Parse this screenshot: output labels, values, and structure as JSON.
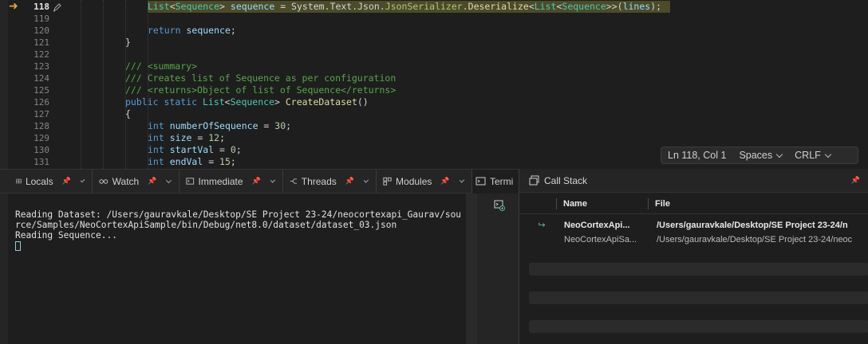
{
  "editor": {
    "line_numbers": [
      "118",
      "119",
      "120",
      "121",
      "122",
      "123",
      "124",
      "125",
      "126",
      "127",
      "128",
      "129",
      "130",
      "131"
    ],
    "status": {
      "position": "Ln 118, Col 1",
      "indent": "Spaces",
      "eol": "CRLF"
    }
  },
  "code_tokens": {
    "l118": [
      "List",
      "<",
      "Sequence",
      "> ",
      "sequence",
      " = System.Text.Json.",
      "JsonSerializer",
      ".",
      "Deserialize",
      "<",
      "List",
      "<",
      "Sequence",
      ">>(",
      "lines",
      ");"
    ],
    "l120": [
      "return",
      " ",
      "sequence",
      ";"
    ],
    "l121": [
      "}"
    ],
    "l123": "/// <summary>",
    "l124": "/// Creates list of Sequence as per configuration",
    "l125": "/// <returns>Object of list of Sequence</returns>",
    "l126": [
      "public",
      " ",
      "static",
      " ",
      "List",
      "<",
      "Sequence",
      "> ",
      "CreateDataset",
      "()"
    ],
    "l127": [
      "{"
    ],
    "l128": [
      "int",
      " ",
      "numberOfSequence",
      " = ",
      "30",
      ";"
    ],
    "l129": [
      "int",
      " ",
      "size",
      " = ",
      "12",
      ";"
    ],
    "l130": [
      "int",
      " ",
      "startVal",
      " = ",
      "0",
      ";"
    ],
    "l131": [
      "int",
      " ",
      "endVal",
      " = ",
      "15",
      ";"
    ]
  },
  "panel_tabs": [
    {
      "label": "Locals",
      "icon": "locals-icon"
    },
    {
      "label": "Watch",
      "icon": "glasses-icon"
    },
    {
      "label": "Immediate",
      "icon": "terminal-prompt-icon"
    },
    {
      "label": "Threads",
      "icon": "threads-icon"
    },
    {
      "label": "Modules",
      "icon": "modules-icon"
    },
    {
      "label": "Termi",
      "icon": "terminal-icon"
    }
  ],
  "terminal": {
    "lines": [
      "Reading Dataset: /Users/gauravkale/Desktop/SE Project 23-24/neocortexapi_Gaurav/sou",
      "rce/Samples/NeoCortexApiSample/bin/Debug/net8.0/dataset/dataset_03.json",
      "Reading Sequence..."
    ]
  },
  "call_stack": {
    "title": "Call Stack",
    "columns": {
      "name": "Name",
      "file": "File"
    },
    "rows": [
      {
        "name": "NeoCortexApi...",
        "file": "/Users/gauravkale/Desktop/SE Project 23-24/n",
        "current": true
      },
      {
        "name": "NeoCortexApiSa...",
        "file": "/Users/gauravkale/Desktop/SE Project 23-24/neoc",
        "current": false
      }
    ]
  },
  "colors": {
    "execution_arrow": "#e8a33d",
    "keyword": "#569cd6",
    "type": "#4ec9b0",
    "identifier": "#9cdcfe",
    "method": "#dcdcaa",
    "comment": "#57a64a",
    "number": "#b5cea8"
  }
}
